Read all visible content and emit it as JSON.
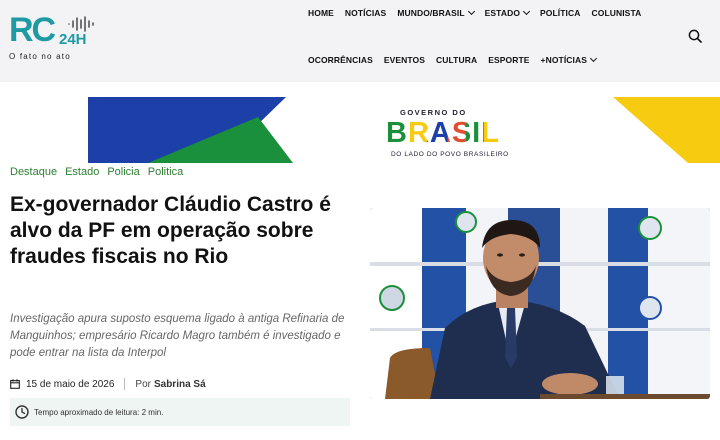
{
  "header": {
    "logo": {
      "letters": "RC",
      "suffix": "24H",
      "tagline": "O fato no ato"
    },
    "nav_top": [
      {
        "label": "HOME",
        "dropdown": false
      },
      {
        "label": "NOTÍCIAS",
        "dropdown": false
      },
      {
        "label": "MUNDO/BRASIL",
        "dropdown": true
      },
      {
        "label": "ESTADO",
        "dropdown": true
      },
      {
        "label": "POLÍTICA",
        "dropdown": false
      },
      {
        "label": "COLUNISTA",
        "dropdown": false
      }
    ],
    "nav_bottom": [
      {
        "label": "OCORRÊNCIAS",
        "dropdown": false
      },
      {
        "label": "EVENTOS",
        "dropdown": false
      },
      {
        "label": "CULTURA",
        "dropdown": false
      },
      {
        "label": "ESPORTE",
        "dropdown": false
      },
      {
        "label": "+NOTÍCIAS",
        "dropdown": true
      }
    ],
    "search_icon": "search-icon"
  },
  "banner": {
    "top_line": "GOVERNO DO",
    "brand": "BRASIL",
    "sub_line": "DO LADO DO POVO BRASILEIRO",
    "colors": {
      "blue": "#1c3fa8",
      "green": "#1a8f3c",
      "yellow": "#f7cb0f"
    }
  },
  "article": {
    "categories": [
      "Destaque",
      "Estado",
      "Policia",
      "Politica"
    ],
    "title": "Ex-governador Cláudio Castro é alvo da PF em operação sobre fraudes fiscais no Rio",
    "excerpt": "Investigação apura suposto esquema ligado à antiga Refinaria de Manguinhos; empresário Ricardo Magro também é investigado e pode entrar na lista da Interpol",
    "date": "15 de maio de 2026",
    "by_label": "Por",
    "author": "Sabrina Sá",
    "reading_time": "Tempo aproximado de leitura: 2 min.",
    "accent_color": "#2f7d32"
  }
}
